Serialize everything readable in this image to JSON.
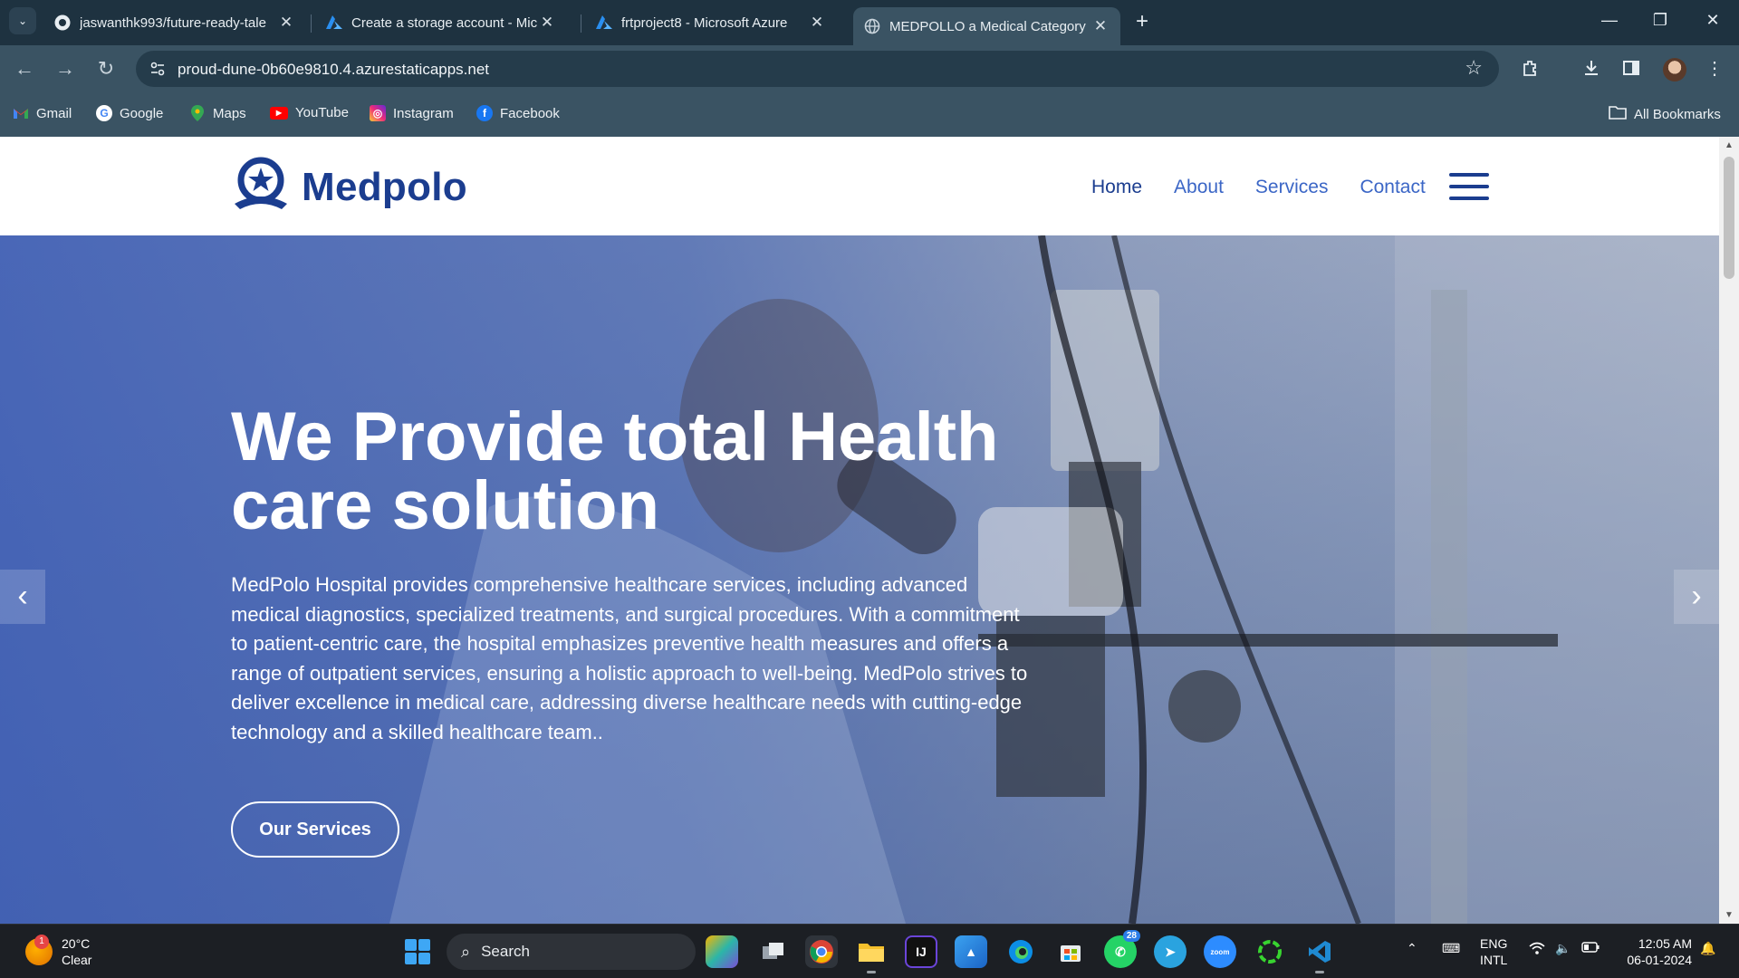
{
  "browser": {
    "tabs": [
      {
        "title": "jaswanthk993/future-ready-tale",
        "icon": "github-icon"
      },
      {
        "title": "Create a storage account - Micr",
        "icon": "azure-icon"
      },
      {
        "title": "frtproject8 - Microsoft Azure",
        "icon": "azure-icon"
      },
      {
        "title": "MEDPOLLO a Medical Category",
        "icon": "globe-icon",
        "active": true
      }
    ],
    "url": "proud-dune-0b60e9810.4.azurestaticapps.net",
    "bookmarks": [
      "Gmail",
      "Google",
      "Maps",
      "YouTube",
      "Instagram",
      "Facebook"
    ],
    "all_bookmarks": "All Bookmarks"
  },
  "site": {
    "brand": "Medpolo",
    "nav": [
      {
        "label": "Home",
        "active": true
      },
      {
        "label": "About"
      },
      {
        "label": "Services"
      },
      {
        "label": "Contact"
      }
    ],
    "hero": {
      "title": "We Provide total Health care solution",
      "text": "MedPolo Hospital provides comprehensive healthcare services, including advanced medical diagnostics, specialized treatments, and surgical procedures. With a commitment to patient-centric care, the hospital emphasizes preventive health measures and offers a range of outpatient services, ensuring a holistic approach to well-being. MedPolo strives to deliver excellence in medical care, addressing diverse healthcare needs with cutting-edge technology and a skilled healthcare team..",
      "button": "Our Services"
    },
    "colors": {
      "brand": "#1b3d8f",
      "nav_link": "#3b66c6",
      "hero_overlay": "#3c5cb4"
    }
  },
  "taskbar": {
    "weather": {
      "temp": "20°C",
      "condition": "Clear",
      "badge": "1"
    },
    "search": "Search",
    "whatsapp_badge": "28",
    "zoom_label": "zoom",
    "lang_top": "ENG",
    "lang_bottom": "INTL",
    "time": "12:05 AM",
    "date": "06-01-2024"
  }
}
